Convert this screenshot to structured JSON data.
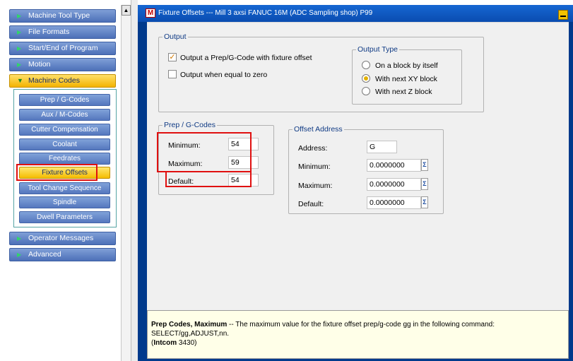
{
  "nav": {
    "items": [
      {
        "label": "Machine Tool Type"
      },
      {
        "label": "File Formats"
      },
      {
        "label": "Start/End of Program"
      },
      {
        "label": "Motion"
      },
      {
        "label": "Machine Codes"
      },
      {
        "label": "Operator Messages"
      },
      {
        "label": "Advanced"
      }
    ],
    "submenu": [
      {
        "label": "Prep / G-Codes"
      },
      {
        "label": "Aux / M-Codes"
      },
      {
        "label": "Cutter Compensation"
      },
      {
        "label": "Coolant"
      },
      {
        "label": "Feedrates"
      },
      {
        "label": "Fixture Offsets"
      },
      {
        "label": "Tool Change Sequence"
      },
      {
        "label": "Spindle"
      },
      {
        "label": "Dwell Parameters"
      }
    ],
    "selected": "Fixture Offsets"
  },
  "window": {
    "title": "Fixture Offsets --- Mill 3 axsi FANUC 16M (ADC Sampling shop) P99",
    "icon_letter": "M"
  },
  "output": {
    "legend": "Output",
    "checkbox_output_label": "Output a Prep/G-Code with fixture offset",
    "checkbox_output_checked": true,
    "checkbox_equal_label": "Output when equal to zero",
    "checkbox_equal_checked": false,
    "output_type": {
      "legend": "Output Type",
      "options": [
        {
          "label": "On a block by itself",
          "checked": false
        },
        {
          "label": "With next XY block",
          "checked": true
        },
        {
          "label": "With next Z block",
          "checked": false
        }
      ]
    }
  },
  "prep_codes": {
    "legend": "Prep / G-Codes",
    "minimum_label": "Minimum:",
    "minimum_value": "54",
    "maximum_label": "Maximum:",
    "maximum_value": "59",
    "default_label": "Default:",
    "default_value": "54"
  },
  "offset_address": {
    "legend": "Offset Address",
    "address_label": "Address:",
    "address_value": "G",
    "minimum_label": "Minimum:",
    "minimum_value": "0.0000000",
    "maximum_label": "Maximum:",
    "maximum_value": "0.0000000",
    "default_label": "Default:",
    "default_value": "0.0000000"
  },
  "help": {
    "title": "Prep Codes, Maximum",
    "text": " -- The maximum value for the fixture offset prep/g-code gg in the following command: SELECT/gg,ADJUST,nn.",
    "ref_label": "Intcom",
    "ref_number": " 3430)"
  },
  "colors": {
    "window_frame": "#003a8c",
    "nav_button": "#5b7fc4",
    "nav_button_active": "#f5bd00",
    "highlight_box": "#e01010",
    "help_background": "#ffffe8"
  }
}
